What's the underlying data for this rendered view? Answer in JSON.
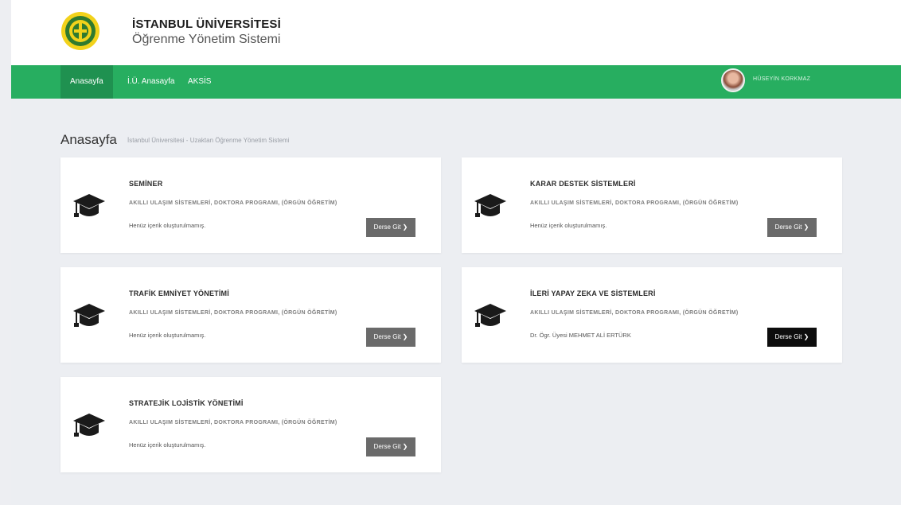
{
  "header": {
    "logo_icon": "university-seal-logo",
    "title": "İSTANBUL ÜNİVERSİTESİ",
    "subtitle": "Öğrenme Yönetim Sistemi"
  },
  "nav": {
    "items": [
      {
        "label": "Anasayfa",
        "active": true
      },
      {
        "label": "İ.Ü. Anasayfa",
        "active": false
      },
      {
        "label": "AKSİS",
        "active": false
      }
    ],
    "accent_color": "#27ae60",
    "user_name": "HÜSEYİN KORKMAZ"
  },
  "page": {
    "title": "Anasayfa",
    "subtitle": "İstanbul Üniversitesi - Uzaktan Öğrenme Yönetim Sistemi"
  },
  "courses": [
    {
      "title": "SEMİNER",
      "program": "AKILLI ULAŞIM SİSTEMLERİ, DOKTORA PROGRAMI, (ÖRGÜN ÖĞRETİM)",
      "status": "Henüz içerik oluşturulmamış.",
      "button_label": "Derse Git ❯",
      "icon": "graduation-cap-icon"
    },
    {
      "title": "KARAR DESTEK SİSTEMLERİ",
      "program": "AKILLI ULAŞIM SİSTEMLERİ, DOKTORA PROGRAMI, (ÖRGÜN ÖĞRETİM)",
      "status": "Henüz içerik oluşturulmamış.",
      "button_label": "Derse Git ❯",
      "icon": "graduation-cap-icon"
    },
    {
      "title": "TRAFİK EMNİYET YÖNETİMİ",
      "program": "AKILLI ULAŞIM SİSTEMLERİ, DOKTORA PROGRAMI, (ÖRGÜN ÖĞRETİM)",
      "status": "Henüz içerik oluşturulmamış.",
      "button_label": "Derse Git ❯",
      "icon": "graduation-cap-icon"
    },
    {
      "title": "İLERİ YAPAY ZEKA VE SİSTEMLERİ",
      "program": "AKILLI ULAŞIM SİSTEMLERİ, DOKTORA PROGRAMI, (ÖRGÜN ÖĞRETİM)",
      "status": "Dr. Ögr. Üyesi MEHMET ALİ ERTÜRK",
      "button_label": "Derse Git ❯",
      "icon": "graduation-cap-icon"
    },
    {
      "title": "STRATEJİK LOJİSTİK YÖNETİMİ",
      "program": "AKILLI ULAŞIM SİSTEMLERİ, DOKTORA PROGRAMI, (ÖRGÜN ÖĞRETİM)",
      "status": "Henüz içerik oluşturulmamış.",
      "button_label": "Derse Git ❯",
      "icon": "graduation-cap-icon"
    }
  ]
}
